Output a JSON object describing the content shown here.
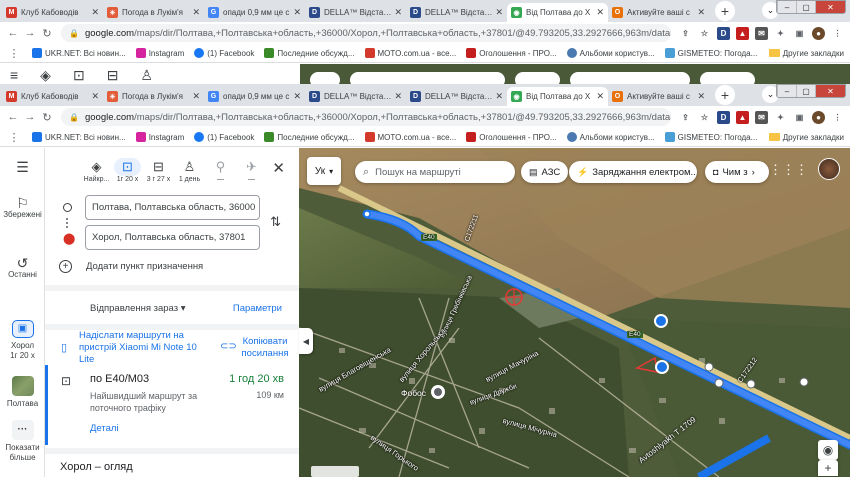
{
  "browser": {
    "tabs": [
      {
        "label": "Клуб Кабоводів",
        "fav": "moto-icon",
        "color": "#d33a2c"
      },
      {
        "label": "Погода в Лукім'я",
        "fav": "weather-icon",
        "color": "#e25c3a"
      },
      {
        "label": "опади 0,9 мм це с",
        "fav": "google-icon",
        "color": "#4285f4"
      },
      {
        "label": "DELLA™ Відстань",
        "fav": "della-icon",
        "color": "#2a4a8a"
      },
      {
        "label": "DELLA™ Відстань",
        "fav": "della-icon",
        "color": "#2a4a8a"
      },
      {
        "label": "Від Полтава до Х",
        "fav": "maps-pin-icon",
        "color": "#34a853",
        "active": true
      },
      {
        "label": "Активуйте ваші с",
        "fav": "office-icon",
        "color": "#e8710a"
      }
    ],
    "new_tab": "+",
    "tab_menu": "⌄",
    "win_min": "–",
    "win_max": "▢",
    "win_close": "✕",
    "url_host": "google.com",
    "url_path": "/maps/dir/Полтава,+Полтавська+область,+36000/Хорол,+Полтавська+область,+37801/@49.793205,33.2927666,963m/data=!...",
    "bookmarks": [
      {
        "label": "UKR.NET: Всі новин...",
        "color": "#1a73e8"
      },
      {
        "label": "Instagram",
        "color": "#d6249f"
      },
      {
        "label": "(1) Facebook",
        "color": "#1877f2"
      },
      {
        "label": "Последние обсужд...",
        "color": "#3a8a2a"
      },
      {
        "label": "MOTO.com.ua - все...",
        "color": "#d33a2c"
      },
      {
        "label": "Оголошення - ПРО...",
        "color": "#c41e1e"
      },
      {
        "label": "Альбоми користув...",
        "color": "#4a7ab0"
      },
      {
        "label": "GISMETEO: Погода...",
        "color": "#4a9ed6"
      }
    ],
    "other_bookmarks": "Другие закладки"
  },
  "rail": {
    "menu": "☰",
    "saved": "Збережені",
    "recent": "Останні",
    "route_label": "Хорол",
    "route_time": "1г 20 х",
    "poltava": "Полтава",
    "more": "Показати більше"
  },
  "panel": {
    "modes": [
      {
        "label": "Найкр...",
        "icon": "◈",
        "name": "best-mode"
      },
      {
        "label": "1г 20 х",
        "icon": "🚗",
        "name": "car-mode",
        "selected": true
      },
      {
        "label": "3 г 27 х",
        "icon": "🚌",
        "name": "transit-mode"
      },
      {
        "label": "1 день",
        "icon": "🚶",
        "name": "walk-mode"
      },
      {
        "label": "—",
        "icon": "🚲",
        "name": "bike-mode"
      },
      {
        "label": "—",
        "icon": "✈",
        "name": "flight-mode"
      }
    ],
    "close": "✕",
    "origin": "Полтава, Полтавська область, 36000",
    "destination": "Хорол, Полтавська область, 37801",
    "add_destination": "Додати пункт призначення",
    "depart": "Відправлення зараз",
    "params": "Параметри",
    "send_to_phone": "Надіслати маршрути на пристрій Xiaomi Mi Note 10 Lite",
    "copy_link": "Копіювати посилання",
    "route": {
      "via": "по E40/M03",
      "time": "1 год 20 хв",
      "desc": "Найшвидший маршрут за поточного трафіку",
      "distance": "109 км",
      "details": "Деталі"
    },
    "overview": "Хорол – огляд"
  },
  "map": {
    "lang": "Ук",
    "search_placeholder": "Пошук на маршруті",
    "chips": [
      {
        "label": "АЗС",
        "icon": "⛽"
      },
      {
        "label": "Заряджання електром...",
        "icon": "🔌"
      },
      {
        "label": "Чим з",
        "icon": "📷"
      }
    ],
    "labels": {
      "e40_a": "E40",
      "e40_b": "E40",
      "c172211": "С172211",
      "c172212": "С172212",
      "street_1": "вулиця Гребінківська",
      "street_2": "вулиця Мачуріна",
      "street_3": "вулиця Мічуріна",
      "street_4": "вулиця Хорольська",
      "street_5": "вулиця Дружби",
      "street_6": "вулиця Горького",
      "street_7": "вулиця Благовіщенська",
      "highway": "Avtoshlyakh T 1709",
      "fobos": "Фобос"
    }
  }
}
